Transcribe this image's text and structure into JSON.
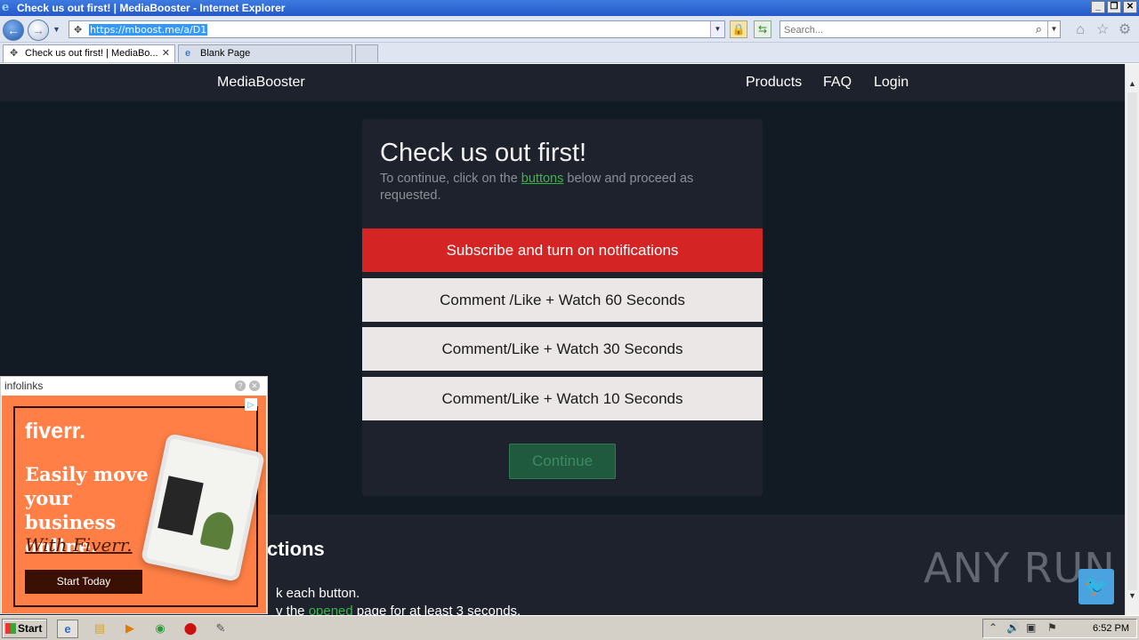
{
  "window": {
    "title": "Check us out first! | MediaBooster - Internet Explorer",
    "controls": [
      "_",
      "❐",
      "✕"
    ]
  },
  "navbar": {
    "url": "https://mboost.me/a/D1",
    "search_placeholder": "Search..."
  },
  "tabs": [
    {
      "label": "Check us out first! | MediaBo...",
      "active": true
    },
    {
      "label": "Blank Page",
      "active": false
    }
  ],
  "site": {
    "brand": "MediaBooster",
    "nav": [
      "Products",
      "FAQ",
      "Login"
    ]
  },
  "card": {
    "title": "Check us out first!",
    "subtitle_pre": "To continue, click on the ",
    "subtitle_link": "buttons",
    "subtitle_post": " below and proceed as requested.",
    "buttons": [
      "Subscribe and turn on notifications",
      "Comment /Like + Watch 60 Seconds",
      "Comment/Like + Watch 30 Seconds",
      "Comment/Like + Watch 10 Seconds"
    ],
    "continue_label": "Continue"
  },
  "instructions": {
    "heading_fragment": "ctions",
    "line1": "k each button.",
    "line2_pre": "v the ",
    "line2_link": "opened",
    "line2_post": " page for at least 3 seconds."
  },
  "ad": {
    "provider": "infolinks",
    "logo": "fiverr.",
    "headline": "Easily move your business online.",
    "tagline": "With Fiverr.",
    "cta": "Start Today",
    "accent": "#ff7f46"
  },
  "watermark": "ANY RUN",
  "taskbar": {
    "start": "Start",
    "time": "6:52 PM"
  },
  "colors": {
    "page_bg": "#121a24",
    "red_button": "#d42424",
    "link_green": "#3bb54a"
  }
}
